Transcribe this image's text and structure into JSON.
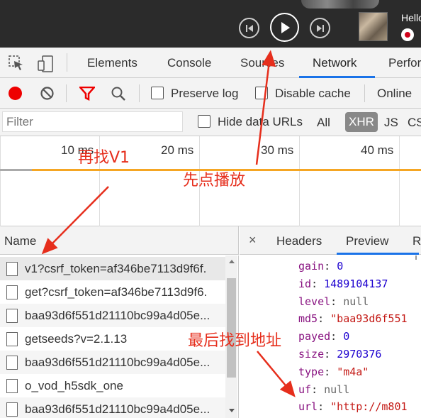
{
  "player": {
    "greeting": "Hello",
    "controls": [
      "previous",
      "play",
      "next"
    ]
  },
  "devtools": {
    "tabs": [
      "Elements",
      "Console",
      "Sources",
      "Network",
      "Perfor"
    ],
    "active_tab": "Network",
    "accent": "#1a73e8"
  },
  "toolbar": {
    "preserve_log": "Preserve log",
    "disable_cache": "Disable cache",
    "throttle": "Online"
  },
  "filter": {
    "placeholder": "Filter",
    "hide_data_urls": "Hide data URLs",
    "types": [
      "All",
      "XHR",
      "JS",
      "CS"
    ],
    "active_type": "XHR"
  },
  "timeline": {
    "ticks": [
      "10 ms",
      "20 ms",
      "30 ms",
      "40 ms"
    ]
  },
  "requests": {
    "header": "Name",
    "rows": [
      "v1?csrf_token=af346be7113d9f6f.",
      "get?csrf_token=af346be7113d9f6.",
      "baa93d6f551d21110bc99a4d05e...",
      "getseeds?v=2.1.13",
      "baa93d6f551d21110bc99a4d05e...",
      "o_vod_h5sdk_one",
      "baa93d6f551d21110bc99a4d05e..."
    ]
  },
  "details": {
    "close": "×",
    "tabs": [
      "Headers",
      "Preview",
      "R"
    ],
    "active_tab": "Preview",
    "json_lines": [
      {
        "key": "gain",
        "value": "0",
        "kind": "num"
      },
      {
        "key": "id",
        "value": "1489104137",
        "kind": "num"
      },
      {
        "key": "level",
        "value": "null",
        "kind": "null"
      },
      {
        "key": "md5",
        "value": "\"baa93d6f551",
        "kind": "str"
      },
      {
        "key": "payed",
        "value": "0",
        "kind": "num"
      },
      {
        "key": "size",
        "value": "2970376",
        "kind": "num"
      },
      {
        "key": "type",
        "value": "\"m4a\"",
        "kind": "str"
      },
      {
        "key": "uf",
        "value": "null",
        "kind": "null"
      },
      {
        "key": "url",
        "value": "\"http://m801",
        "kind": "str"
      }
    ]
  },
  "annotations": {
    "find_v1": "再找V1",
    "play_first": "先点播放",
    "find_address": "最后找到地址",
    "color": "#e62e1c"
  }
}
